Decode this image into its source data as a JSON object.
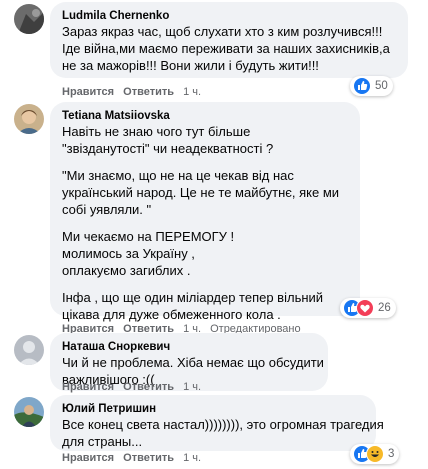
{
  "comments": [
    {
      "author": "Ludmila Chernenko",
      "lines": [
        "Зараз якраз час, щоб слухати хто з ким розлучився!!!",
        "Іде війна,ми маємо переживати за наших захисників,а",
        "не за мажорів!!! Вони жили і будуть жити!!!"
      ],
      "actions": {
        "like": "Нравится",
        "reply": "Ответить",
        "time": "1 ч."
      },
      "reaction_count": "50",
      "reaction_icons": [
        "like-icon"
      ]
    },
    {
      "author": "Tetiana Matsiiovska",
      "lines": [
        "Навіть не знаю чого тут більше",
        "\"звізданутості\" чи неадекватності ?",
        "",
        "\"Ми знаємо, що не на це чекав від нас",
        "український народ. Це не те майбутнє, яке ми",
        "собі уявляли. \"",
        "",
        "Ми чекаємо на ПЕРЕМОГУ !",
        "молимось за Україну ,",
        "оплакуємо загиблих .",
        "",
        "Інфа , що ще один міліардер тепер вільний",
        "цікава для дуже обмеженного кола ."
      ],
      "actions": {
        "like": "Нравится",
        "reply": "Ответить",
        "time": "1 ч.",
        "edited": "Отредактировано"
      },
      "reaction_count": "26",
      "reaction_icons": [
        "like-icon",
        "love-icon"
      ]
    },
    {
      "author": "Наташа Сноркевич",
      "lines": [
        "Чи й не проблема. Хіба немає що обсудити",
        "важливішого :(("
      ],
      "actions": {
        "like": "Нравится",
        "reply": "Ответить",
        "time": "1 ч."
      }
    },
    {
      "author": "Юлий Петришин",
      "lines": [
        "Все конец света настал)))))))), это огромная трагедия",
        "для страны..."
      ],
      "actions": {
        "like": "Нравится",
        "reply": "Ответить",
        "time": "1 ч."
      },
      "reaction_count": "3",
      "reaction_icons": [
        "like-icon",
        "haha-icon"
      ]
    }
  ],
  "colors": {
    "bubble": "#f0f2f5",
    "secondary_text": "#65676b",
    "like_blue": "#1877f2",
    "love_red": "#f33e58",
    "haha_yellow": "#f7b928"
  }
}
